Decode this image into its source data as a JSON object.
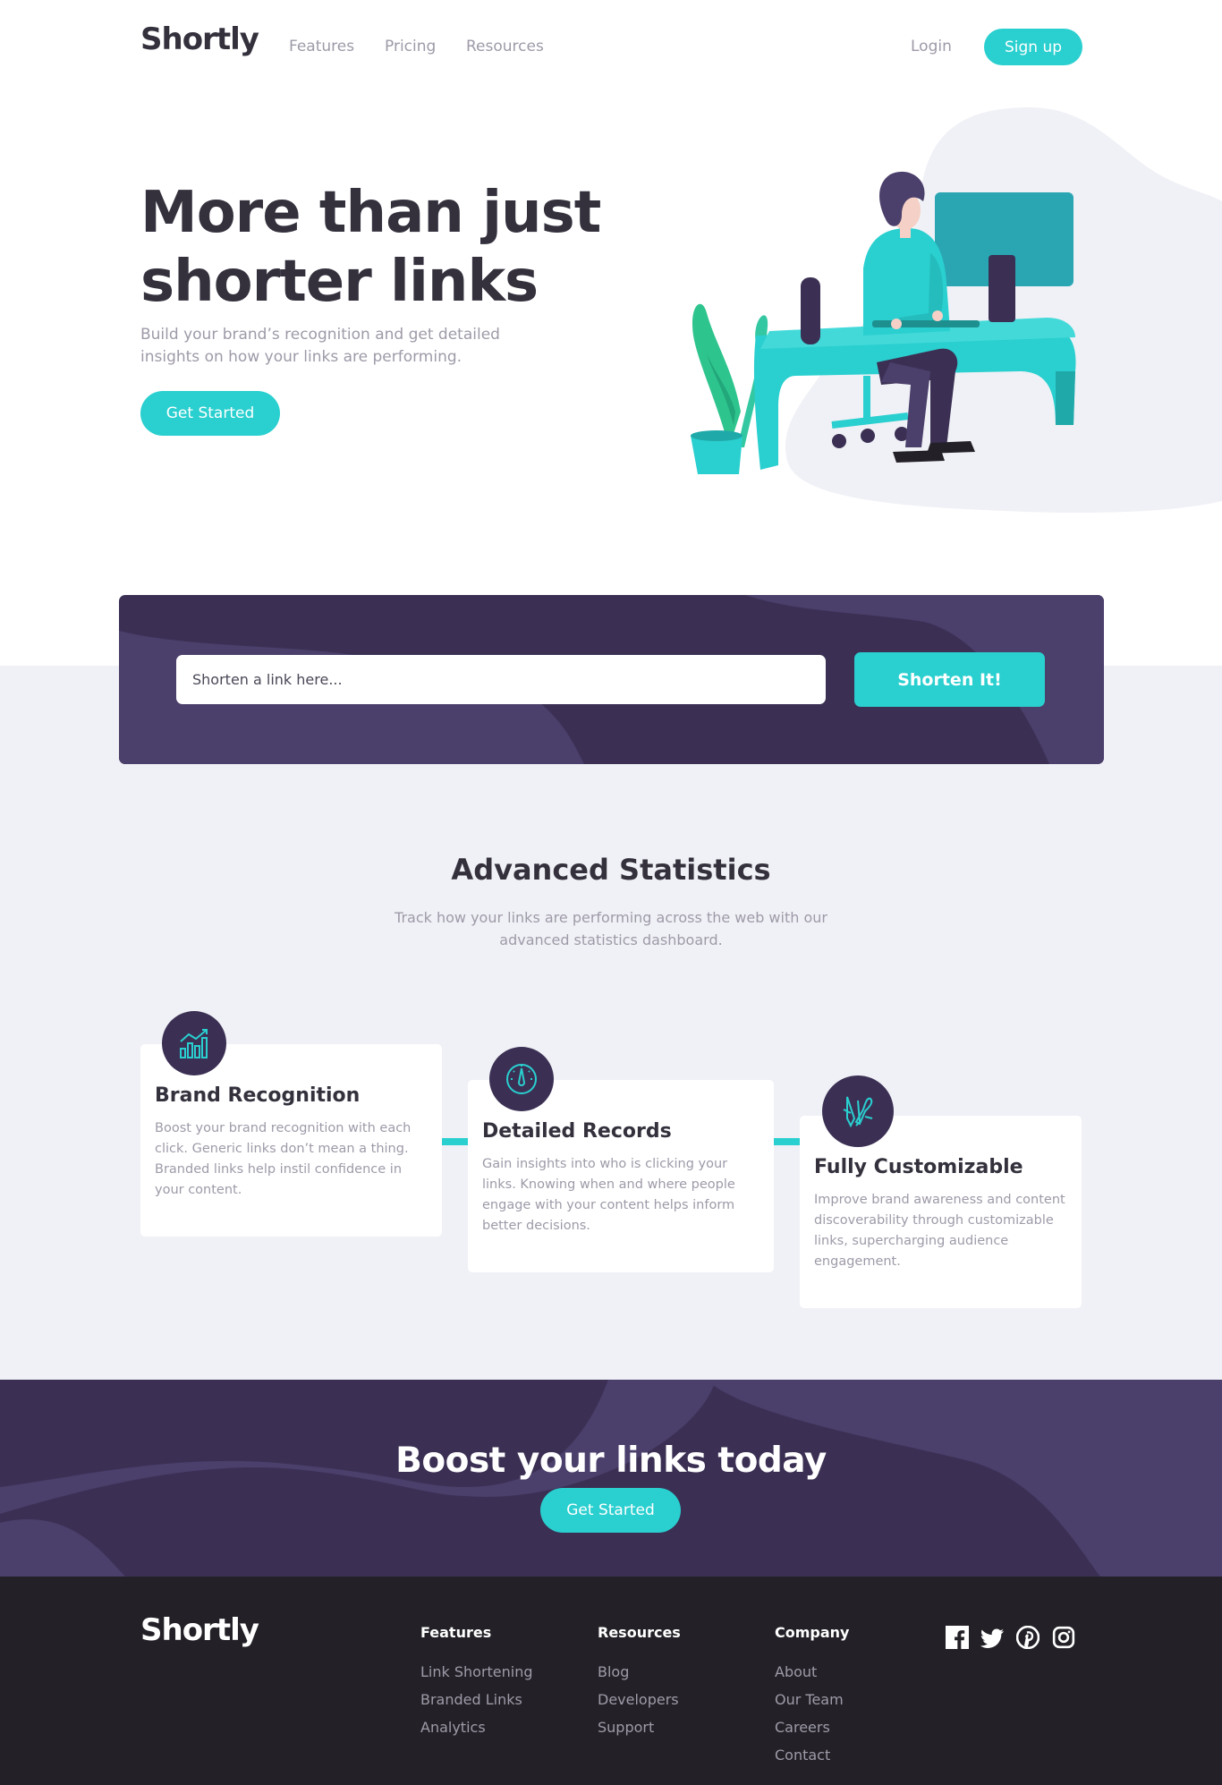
{
  "nav": {
    "logo": "Shortly",
    "links": [
      "Features",
      "Pricing",
      "Resources"
    ],
    "login": "Login",
    "signup": "Sign up"
  },
  "hero": {
    "title": "More than just shorter links",
    "subtitle": "Build your brand’s recognition and get detailed insights on how your links are performing.",
    "cta": "Get Started"
  },
  "shorten": {
    "placeholder": "Shorten a link here...",
    "button": "Shorten It!"
  },
  "stats": {
    "title": "Advanced Statistics",
    "subtitle": "Track how your links are performing across the web with our advanced statistics dashboard.",
    "cards": [
      {
        "title": "Brand Recognition",
        "text": "Boost your brand recognition with each click. Generic links don’t mean a thing. Branded links help instil confidence in your content.",
        "icon": "bar-chart-icon"
      },
      {
        "title": "Detailed Records",
        "text": "Gain insights into who is clicking your links. Knowing when and where people engage with your content helps inform better decisions.",
        "icon": "speedometer-icon"
      },
      {
        "title": "Fully Customizable",
        "text": "Improve brand awareness and content discoverability through customizable links, supercharging audience engagement.",
        "icon": "pens-icon"
      }
    ]
  },
  "boost": {
    "title": "Boost your links today",
    "cta": "Get Started"
  },
  "footer": {
    "logo": "Shortly",
    "columns": [
      {
        "heading": "Features",
        "links": [
          "Link Shortening",
          "Branded Links",
          "Analytics"
        ]
      },
      {
        "heading": "Resources",
        "links": [
          "Blog",
          "Developers",
          "Support"
        ]
      },
      {
        "heading": "Company",
        "links": [
          "About",
          "Our Team",
          "Careers",
          "Contact"
        ]
      }
    ],
    "social": [
      "facebook-icon",
      "twitter-icon",
      "pinterest-icon",
      "instagram-icon"
    ]
  },
  "colors": {
    "cyan": "#2acfcf",
    "dark_violet": "#3b3054",
    "grayish_violet": "#9e9aa8",
    "very_dark_blue": "#34313d",
    "footer_bg": "#232127"
  }
}
